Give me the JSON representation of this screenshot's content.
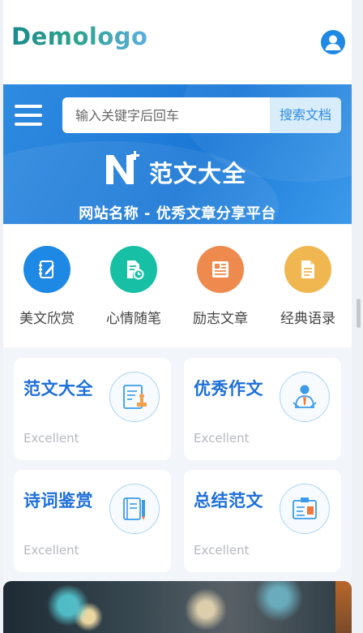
{
  "header": {
    "logo_text": "Demologo",
    "user_icon": "user-icon"
  },
  "banner": {
    "menu_icon": "hamburger-menu-icon",
    "search": {
      "placeholder": "输入关键字后回车",
      "value": "",
      "button_label": "搜索文档"
    },
    "brand_icon": "n-plus-logo-icon",
    "brand_text": "范文大全",
    "subtitle": "网站名称 - 优秀文章分享平台"
  },
  "quick_nav": [
    {
      "label": "美文欣赏",
      "icon": "notebook-pen-icon",
      "color": "#1e88e5"
    },
    {
      "label": "心情随笔",
      "icon": "document-clock-icon",
      "color": "#17bfa5"
    },
    {
      "label": "励志文章",
      "icon": "newspaper-icon",
      "color": "#ef8a4e"
    },
    {
      "label": "经典语录",
      "icon": "document-icon",
      "color": "#f0b750"
    }
  ],
  "cards": [
    {
      "title": "范文大全",
      "subtitle": "Excellent",
      "icon": "document-stamp-icon"
    },
    {
      "title": "优秀作文",
      "subtitle": "Excellent",
      "icon": "person-tie-icon"
    },
    {
      "title": "诗词鉴赏",
      "subtitle": "Excellent",
      "icon": "book-pencil-icon"
    },
    {
      "title": "总结范文",
      "subtitle": "Excellent",
      "icon": "id-badge-icon"
    }
  ],
  "colors": {
    "accent": "#1e88e5",
    "card_title": "#1e6fd9",
    "banner": "#2f8be0"
  }
}
